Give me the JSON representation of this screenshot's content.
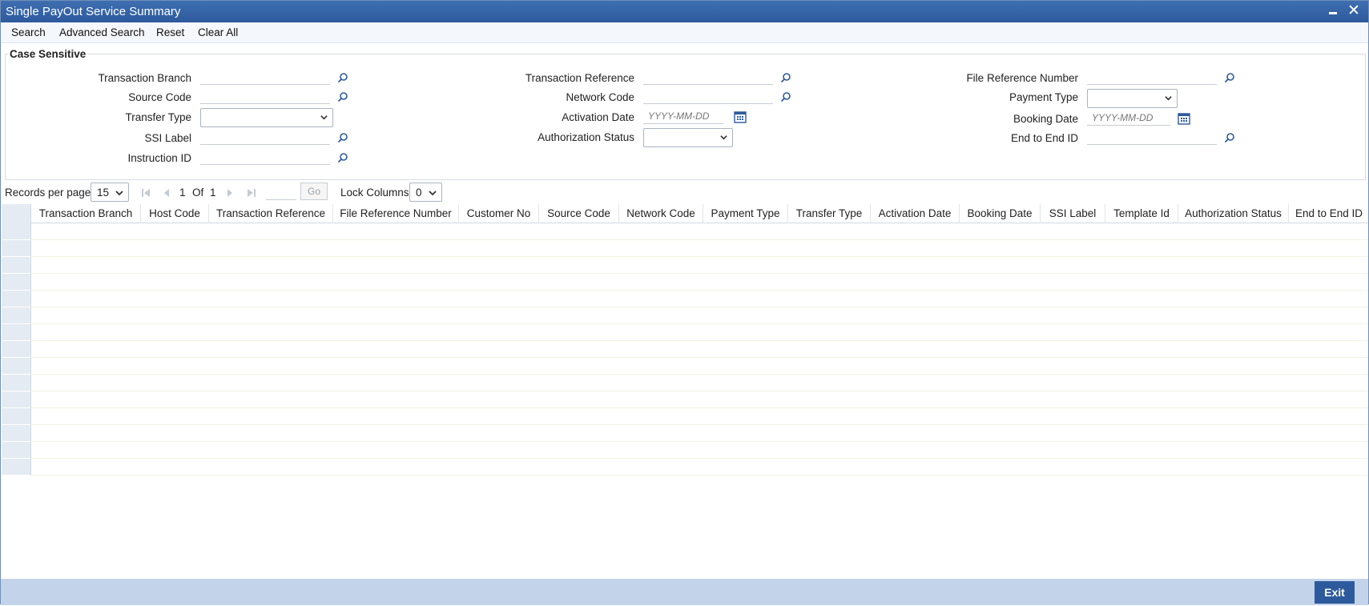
{
  "window": {
    "title": "Single PayOut Service Summary"
  },
  "toolbar": {
    "search": "Search",
    "advanced_search": "Advanced Search",
    "reset": "Reset",
    "clear_all": "Clear All"
  },
  "search_panel": {
    "legend": "Case Sensitive",
    "fields": {
      "transaction_branch": {
        "label": "Transaction Branch",
        "value": ""
      },
      "source_code": {
        "label": "Source Code",
        "value": ""
      },
      "transfer_type": {
        "label": "Transfer Type",
        "value": ""
      },
      "ssi_label": {
        "label": "SSI Label",
        "value": ""
      },
      "instruction_id": {
        "label": "Instruction ID",
        "value": ""
      },
      "transaction_reference": {
        "label": "Transaction Reference",
        "value": ""
      },
      "network_code": {
        "label": "Network Code",
        "value": ""
      },
      "activation_date": {
        "label": "Activation Date",
        "placeholder": "YYYY-MM-DD"
      },
      "authorization_status": {
        "label": "Authorization Status",
        "value": ""
      },
      "file_reference_number": {
        "label": "File Reference Number",
        "value": ""
      },
      "payment_type": {
        "label": "Payment Type",
        "value": ""
      },
      "booking_date": {
        "label": "Booking Date",
        "placeholder": "YYYY-MM-DD"
      },
      "end_to_end_id": {
        "label": "End to End ID",
        "value": ""
      }
    }
  },
  "pager": {
    "records_per_page_label": "Records per page",
    "records_per_page": "15",
    "current_page": "1",
    "of_label": "Of",
    "total_pages": "1",
    "go_label": "Go",
    "lock_columns_label": "Lock Columns",
    "lock_columns": "0"
  },
  "grid": {
    "columns": [
      "Transaction Branch",
      "Host Code",
      "Transaction Reference",
      "File Reference Number",
      "Customer No",
      "Source Code",
      "Network Code",
      "Payment Type",
      "Transfer Type",
      "Activation Date",
      "Booking Date",
      "SSI Label",
      "Template Id",
      "Authorization Status",
      "End to End ID"
    ],
    "empty_rows": 15
  },
  "footer": {
    "exit": "Exit"
  },
  "colors": {
    "titlebar": "#2d5a9c",
    "footer": "#c3d4ea",
    "row_header": "#e4ebf3",
    "exit_button": "#2d5a9c"
  },
  "icons": {
    "lookup": "magnifier-icon",
    "calendar": "calendar-icon",
    "dropdown": "chevron-down-icon"
  }
}
